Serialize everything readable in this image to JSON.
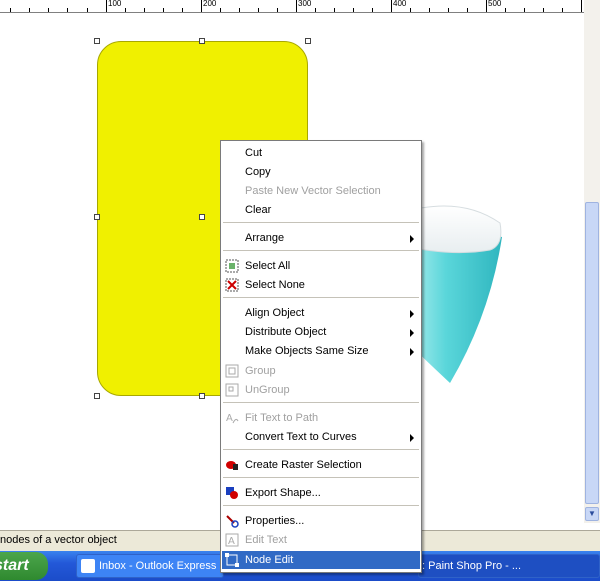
{
  "ruler": {
    "labels": [
      "100",
      "200",
      "300",
      "400",
      "500"
    ]
  },
  "status_bar": {
    "text": "nodes of a vector object"
  },
  "taskbar": {
    "start_label": "start",
    "tasks": [
      {
        "label": "Inbox - Outlook Express",
        "icon": "outlook-express-icon"
      },
      {
        "label": ": Paint Shop Pro - ...",
        "icon": "paint-shop-pro-icon"
      }
    ]
  },
  "context_menu": {
    "items": [
      {
        "label": "Cut",
        "enabled": true
      },
      {
        "label": "Copy",
        "enabled": true
      },
      {
        "label": "Paste New Vector Selection",
        "enabled": false
      },
      {
        "label": "Clear",
        "enabled": true
      },
      {
        "label": "Arrange",
        "enabled": true,
        "submenu": true
      },
      {
        "label": "Select All",
        "enabled": true,
        "icon": "select-all-icon"
      },
      {
        "label": "Select None",
        "enabled": true,
        "icon": "select-none-icon"
      },
      {
        "label": "Align Object",
        "enabled": true,
        "submenu": true
      },
      {
        "label": "Distribute Object",
        "enabled": true,
        "submenu": true
      },
      {
        "label": "Make Objects Same Size",
        "enabled": true,
        "submenu": true
      },
      {
        "label": "Group",
        "enabled": false,
        "icon": "group-icon"
      },
      {
        "label": "UnGroup",
        "enabled": false,
        "icon": "ungroup-icon"
      },
      {
        "label": "Fit Text to Path",
        "enabled": false,
        "icon": "fit-text-to-path-icon"
      },
      {
        "label": "Convert Text to Curves",
        "enabled": true,
        "submenu": true
      },
      {
        "label": "Create Raster Selection",
        "enabled": true,
        "icon": "raster-selection-icon"
      },
      {
        "label": "Export Shape...",
        "enabled": true,
        "icon": "export-shape-icon"
      },
      {
        "label": "Properties...",
        "enabled": true,
        "icon": "properties-icon"
      },
      {
        "label": "Edit Text",
        "enabled": false,
        "icon": "edit-text-icon"
      },
      {
        "label": "Node Edit",
        "enabled": true,
        "icon": "node-edit-icon",
        "highlighted": true
      }
    ]
  },
  "colors": {
    "shape_fill": "#f0f000",
    "menu_highlight": "#316ac5",
    "taskbar": "#245edb",
    "cup": "#4fd3d8"
  }
}
